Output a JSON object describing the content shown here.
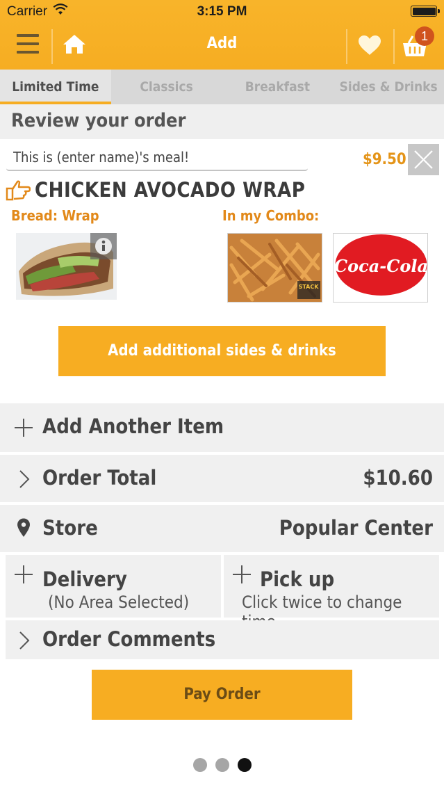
{
  "status_bar": {
    "carrier": "Carrier",
    "time": "3:15 PM"
  },
  "header": {
    "title": "Add",
    "cart_count": "1",
    "accent_color": "#f6ad22"
  },
  "tabs": [
    {
      "label": "Limited Time",
      "active": true
    },
    {
      "label": "Classics"
    },
    {
      "label": "Breakfast"
    },
    {
      "label": "Sides & Drinks"
    }
  ],
  "review": {
    "title": "Review your order",
    "name_input_value": "This is (enter name)'s meal!",
    "price": "$9.50",
    "item_name": "CHICKEN AVOCADO WRAP",
    "bread_label": "Bread: Wrap",
    "combo_label": "In my Combo:",
    "add_sides_button": "Add additional sides & drinks"
  },
  "combo_items": [
    {
      "name": "fries-image",
      "brand_text": "STACK"
    },
    {
      "name": "coca-cola-image",
      "brand_text": "Coca-Cola"
    }
  ],
  "actions": {
    "add_another": "Add Another Item",
    "order_total_label": "Order Total",
    "order_total_value": "$10.60",
    "store_label": "Store",
    "store_value": "Popular Center",
    "delivery_label": "Delivery",
    "delivery_sub": "(No Area Selected)",
    "pickup_label": "Pick up",
    "pickup_sub": "Click twice to change time",
    "comments_label": "Order Comments",
    "pay_button": "Pay Order"
  },
  "pager": {
    "count": 3,
    "active_index": 2
  }
}
